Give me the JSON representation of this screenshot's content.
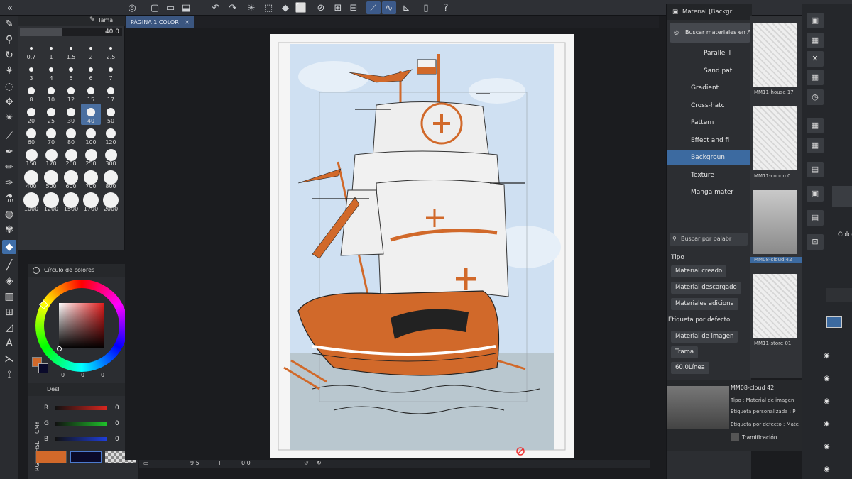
{
  "canvas_tab": {
    "label": "PÁGINA 1 COLOR",
    "close": "✕"
  },
  "brush": {
    "size_value": "40.0",
    "header_label": "Tama",
    "sizes": [
      "0.7",
      "1",
      "1.5",
      "2",
      "2.5",
      "3",
      "4",
      "5",
      "6",
      "7",
      "8",
      "10",
      "12",
      "15",
      "17",
      "20",
      "25",
      "30",
      "40",
      "50",
      "60",
      "70",
      "80",
      "100",
      "120",
      "150",
      "170",
      "200",
      "250",
      "300",
      "400",
      "500",
      "600",
      "700",
      "800",
      "1000",
      "1200",
      "1500",
      "1700",
      "2000"
    ],
    "selected": "40"
  },
  "color_panel": {
    "title": "Círculo de colores",
    "hsv_readout": [
      "0",
      "0",
      "0"
    ]
  },
  "rgb_panel": {
    "tab_label": "Desli",
    "mode_labels": [
      "RGB",
      "HSL",
      "CMY"
    ],
    "channels": [
      {
        "label": "R",
        "value": "0",
        "color": "#d8261f"
      },
      {
        "label": "G",
        "value": "0",
        "color": "#1fbf2a"
      },
      {
        "label": "B",
        "value": "0",
        "color": "#1f3ed8"
      }
    ],
    "main_color": "#d1692a",
    "sub_color": "#0a0a2a"
  },
  "bottom_bar": {
    "zoom": "9.5",
    "rotation": "0.0"
  },
  "material_panel": {
    "title": "Material [Backgr",
    "search_button": "Buscar materiales en AS",
    "tree": [
      "Parallel l",
      "Sand pat",
      "Gradient",
      "Cross-hatc",
      "Pattern",
      "Effect and fi",
      "Backgroun",
      "Texture",
      "Manga mater"
    ],
    "selected_tree": "Backgroun",
    "search_placeholder": "Buscar por palabr",
    "tipo_label": "Tipo",
    "tipo_chips": [
      "Material creado",
      "Material descargado",
      "Materiales adiciona"
    ],
    "tag_label": "Etiqueta por defecto",
    "tag_chips": [
      "Material de imagen",
      "Trama",
      "60.0Línea"
    ],
    "thumbnails": [
      {
        "caption": "MM11-house 17"
      },
      {
        "caption": "MM11-condo 0"
      },
      {
        "caption": "MM08-cloud 42"
      },
      {
        "caption": "MM11-store 01"
      }
    ],
    "detail": {
      "name": "MM08-cloud 42",
      "tipo": "Tipo : Material de imagen",
      "custom_tag": "Etiqueta personalizada : P",
      "default_tag": "Etiqueta por defecto : Mate",
      "tramificacion": "Tramificación"
    }
  },
  "right_col": {
    "label": "Colo"
  },
  "colors": {
    "accent": "#3c6aa0",
    "ship_orange": "#d1692a",
    "sky": "#cfe0f2",
    "sea": "#b9c7cf"
  }
}
